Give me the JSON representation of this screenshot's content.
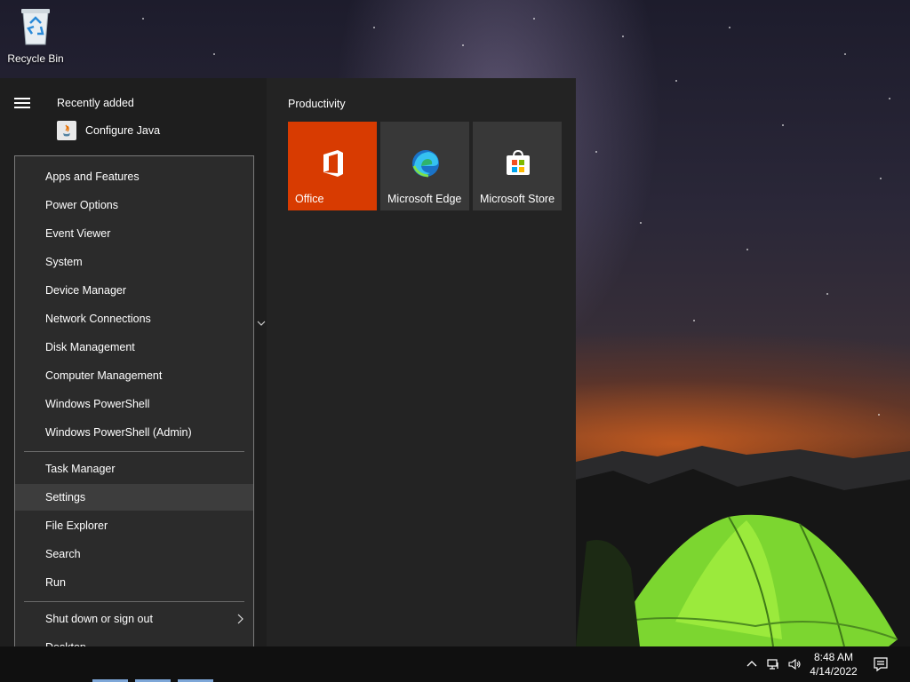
{
  "desktop": {
    "recycle_bin_label": "Recycle Bin"
  },
  "start_menu": {
    "recent_title": "Recently added",
    "recent_items": [
      {
        "label": "Configure Java",
        "icon": "java-icon"
      }
    ],
    "tiles_group_title": "Productivity",
    "tiles": [
      {
        "label": "Office",
        "icon": "office-icon",
        "color": "#d83b01"
      },
      {
        "label": "Microsoft Edge",
        "icon": "edge-icon"
      },
      {
        "label": "Microsoft Store",
        "icon": "store-icon"
      }
    ]
  },
  "context_menu": {
    "items": [
      "Apps and Features",
      "Power Options",
      "Event Viewer",
      "System",
      "Device Manager",
      "Network Connections",
      "Disk Management",
      "Computer Management",
      "Windows PowerShell",
      "Windows PowerShell (Admin)",
      "Task Manager",
      "Settings",
      "File Explorer",
      "Search",
      "Run",
      "Shut down or sign out",
      "Desktop"
    ],
    "highlighted": "Settings",
    "accent_color": "#3d3d3d"
  },
  "taskbar": {
    "time": "8:48 AM",
    "date": "4/14/2022"
  }
}
